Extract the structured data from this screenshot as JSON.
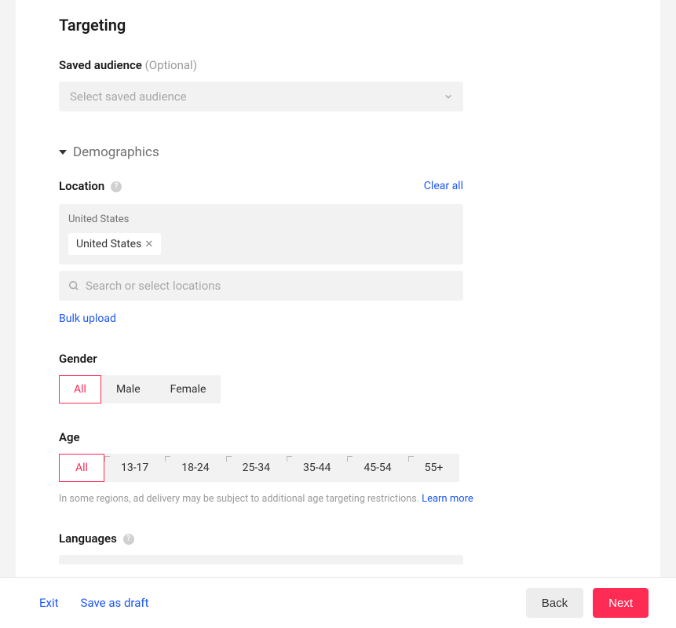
{
  "page": {
    "title": "Targeting"
  },
  "savedAudience": {
    "label": "Saved audience",
    "optional": "(Optional)",
    "placeholder": "Select saved audience"
  },
  "demographics": {
    "title": "Demographics"
  },
  "location": {
    "label": "Location",
    "clearAll": "Clear all",
    "country": "United States",
    "tag": "United States",
    "searchPlaceholder": "Search or select locations",
    "bulkUpload": "Bulk upload"
  },
  "gender": {
    "label": "Gender",
    "options": [
      "All",
      "Male",
      "Female"
    ],
    "selected": "All"
  },
  "age": {
    "label": "Age",
    "options": [
      "All",
      "13-17",
      "18-24",
      "25-34",
      "35-44",
      "45-54",
      "55+"
    ],
    "selected": "All",
    "note_prefix": "In some regions, ad delivery may be subject to additional age targeting restrictions. ",
    "note_link": "Learn more"
  },
  "languages": {
    "label": "Languages"
  },
  "footer": {
    "exit": "Exit",
    "saveDraft": "Save as draft",
    "back": "Back",
    "next": "Next"
  }
}
